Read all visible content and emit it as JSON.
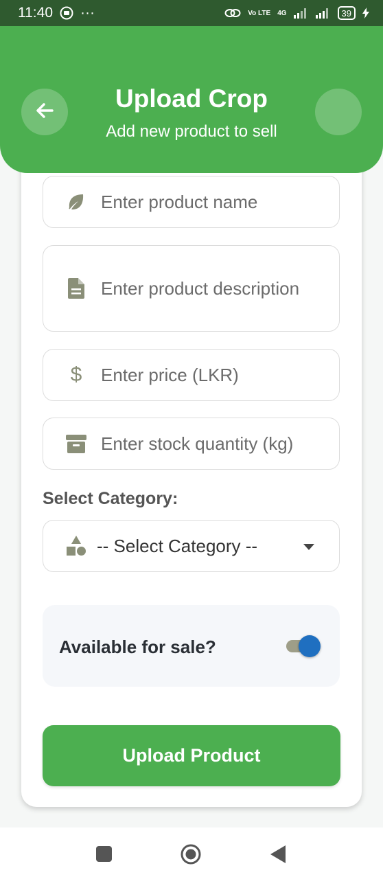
{
  "status_bar": {
    "time": "11:40",
    "more": "···",
    "network": "4G",
    "volte": "Vo LTE",
    "battery": "39"
  },
  "header": {
    "title": "Upload Crop",
    "subtitle": "Add new product to sell"
  },
  "form": {
    "product_name_placeholder": "Enter product name",
    "description_placeholder": "Enter product description",
    "price_placeholder": "Enter price (LKR)",
    "price_icon": "$",
    "stock_placeholder": "Enter stock quantity (kg)",
    "category_label": "Select Category:",
    "category_selected": "-- Select Category --",
    "available_label": "Available for sale?",
    "available_on": true,
    "submit_label": "Upload Product"
  },
  "colors": {
    "primary": "#4caf50",
    "status_bar": "#2f5a2f",
    "icon": "#8a8f78",
    "toggle_thumb": "#1f6fc0"
  },
  "icons": {
    "back": "arrow-left-icon",
    "name": "leaf-icon",
    "description": "document-icon",
    "price": "dollar-icon",
    "stock": "archive-box-icon",
    "category": "shapes-icon"
  }
}
